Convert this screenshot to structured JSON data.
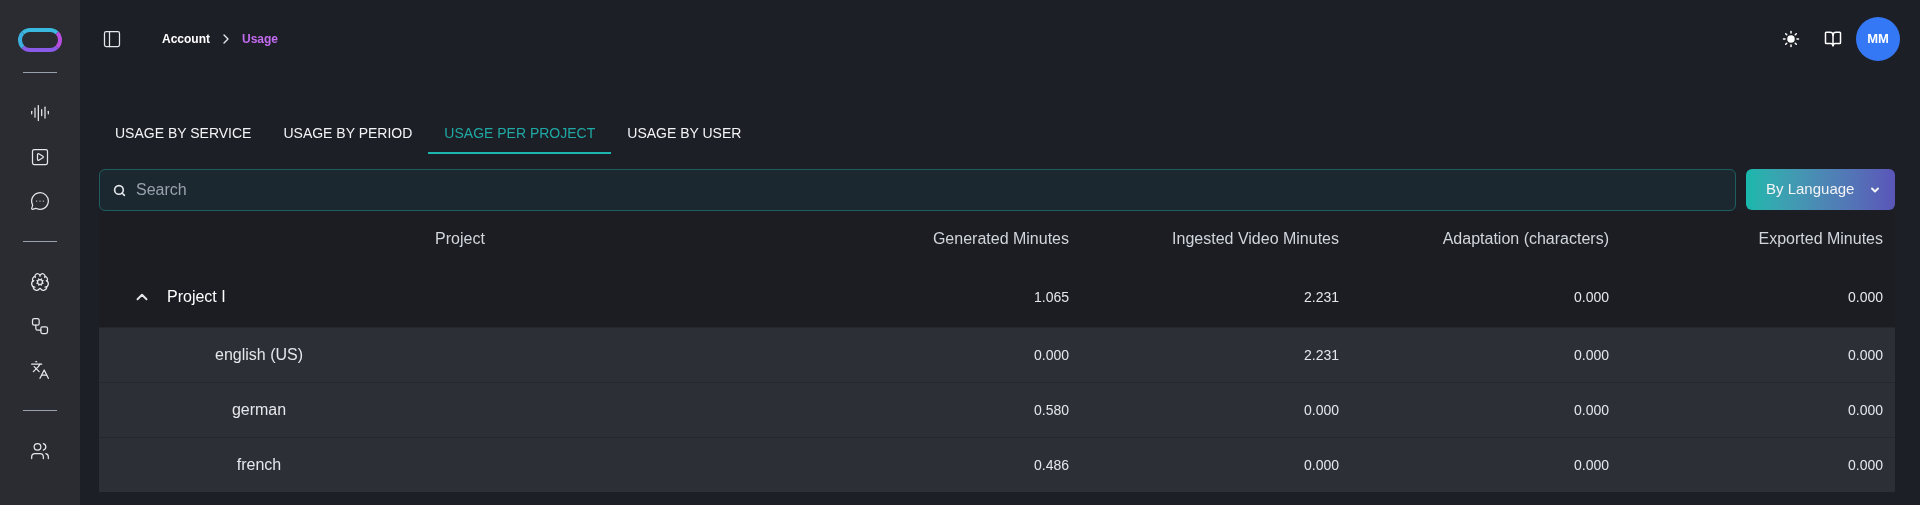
{
  "breadcrumb": [
    {
      "label": "Account",
      "selected": false
    },
    {
      "label": "Usage",
      "selected": true
    }
  ],
  "user": {
    "initials": "MM"
  },
  "tabs": [
    {
      "label": "USAGE BY SERVICE",
      "selected": false
    },
    {
      "label": "USAGE BY PERIOD",
      "selected": false
    },
    {
      "label": "USAGE PER PROJECT",
      "selected": true
    },
    {
      "label": "USAGE BY USER",
      "selected": false
    }
  ],
  "search": {
    "placeholder": "Search"
  },
  "group_by": {
    "label": "By Language"
  },
  "table": {
    "columns": [
      "Project",
      "Generated Minutes",
      "Ingested Video Minutes",
      "Adaptation (characters)",
      "Exported Minutes"
    ],
    "rows": [
      {
        "name": "Project I",
        "expanded": true,
        "values": [
          "1.065",
          "2.231",
          "0.000",
          "0.000"
        ],
        "children": [
          {
            "name": "english (US)",
            "values": [
              "0.000",
              "2.231",
              "0.000",
              "0.000"
            ]
          },
          {
            "name": "german",
            "values": [
              "0.580",
              "0.000",
              "0.000",
              "0.000"
            ]
          },
          {
            "name": "french",
            "values": [
              "0.486",
              "0.000",
              "0.000",
              "0.000"
            ]
          }
        ]
      }
    ]
  }
}
